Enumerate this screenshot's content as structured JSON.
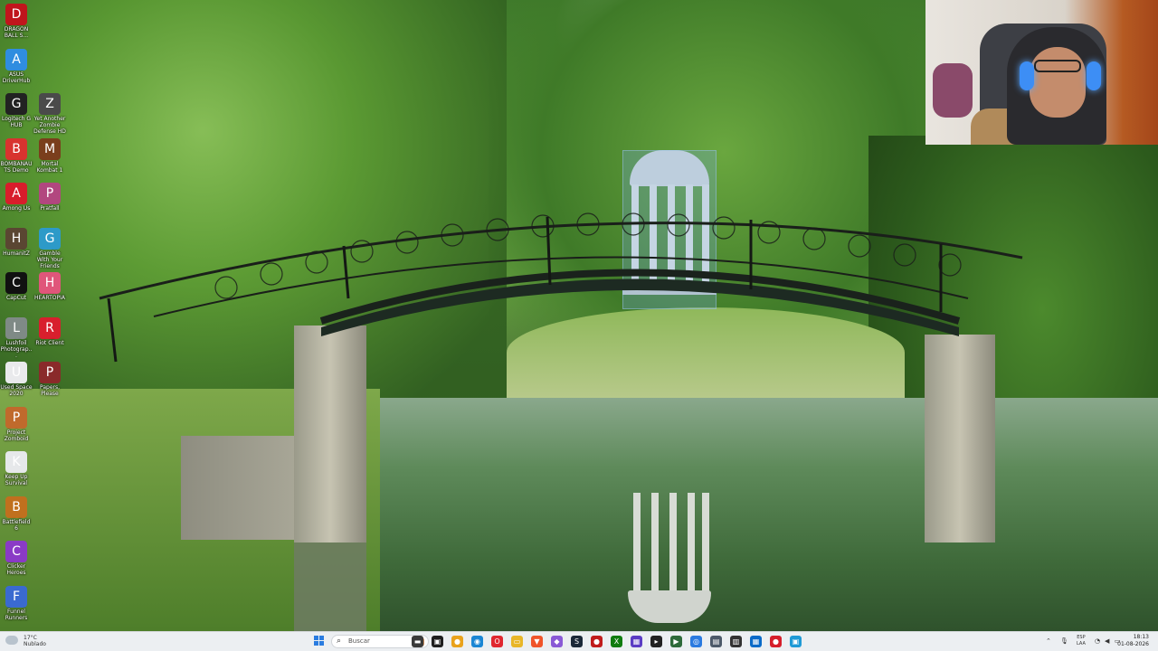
{
  "desktop": {
    "icons": [
      {
        "label": "DRAGON BALL S...",
        "glyph": "D",
        "color": "#c0151c"
      },
      {
        "label": "ASUS DriverHub",
        "glyph": "A",
        "color": "#2f8de0"
      },
      {
        "label": "Logitech G HUB",
        "glyph": "G",
        "color": "#222222"
      },
      {
        "label": "Yet Another Zombie Defense HD",
        "glyph": "Z",
        "color": "#4a4a4a"
      },
      {
        "label": "BOMBANAUTS Demo",
        "glyph": "B",
        "color": "#d8332f"
      },
      {
        "label": "Mortal Kombat 1",
        "glyph": "M",
        "color": "#7a3e1c"
      },
      {
        "label": "Among Us",
        "glyph": "A",
        "color": "#d81d2b"
      },
      {
        "label": "Pratfall",
        "glyph": "P",
        "color": "#b2477f"
      },
      {
        "label": "HumanitZ",
        "glyph": "H",
        "color": "#5a4632"
      },
      {
        "label": "Gamble With Your Friends",
        "glyph": "G",
        "color": "#2d9ac8"
      },
      {
        "label": "CapCut",
        "glyph": "C",
        "color": "#111111"
      },
      {
        "label": "HEARTOPIA",
        "glyph": "H",
        "color": "#e0567a"
      },
      {
        "label": "Lushfoil Photograp...",
        "glyph": "L",
        "color": "#7f8a86"
      },
      {
        "label": "Riot Client",
        "glyph": "R",
        "color": "#d81f2d"
      },
      {
        "label": "Used Space 2020",
        "glyph": "U",
        "color": "#e9eaec"
      },
      {
        "label": "Papers, Please",
        "glyph": "P",
        "color": "#8a2a2a"
      },
      {
        "label": "Project Zomboid",
        "glyph": "P",
        "color": "#c06a2c"
      },
      {
        "label": "Keep Up Survival",
        "glyph": "K",
        "color": "#e6e8ea"
      },
      {
        "label": "Battlefield 6",
        "glyph": "B",
        "color": "#c0701e"
      },
      {
        "label": "Clicker Heroes",
        "glyph": "C",
        "color": "#8a3ac6"
      },
      {
        "label": "Funnel Runners",
        "glyph": "F",
        "color": "#3a6ad0"
      }
    ]
  },
  "taskbar": {
    "weather": {
      "temp": "17°C",
      "condition": "Nublado"
    },
    "search_placeholder": "Buscar",
    "apps": [
      {
        "name": "file-explorer",
        "glyph": "▬",
        "color": "#3a3a3a"
      },
      {
        "name": "app-2",
        "glyph": "▣",
        "color": "#1e1e1e"
      },
      {
        "name": "chrome",
        "glyph": "●",
        "color": "#e9a21c"
      },
      {
        "name": "edge",
        "glyph": "◉",
        "color": "#1b86d4"
      },
      {
        "name": "opera",
        "glyph": "O",
        "color": "#e0272f"
      },
      {
        "name": "folder",
        "glyph": "▭",
        "color": "#e8b628"
      },
      {
        "name": "brave",
        "glyph": "▼",
        "color": "#f0542a"
      },
      {
        "name": "app-8",
        "glyph": "◆",
        "color": "#8a5ad6"
      },
      {
        "name": "steam",
        "glyph": "S",
        "color": "#1b2838"
      },
      {
        "name": "app-10",
        "glyph": "●",
        "color": "#c01c1c"
      },
      {
        "name": "xbox",
        "glyph": "X",
        "color": "#107c10"
      },
      {
        "name": "app-12",
        "glyph": "▦",
        "color": "#5b3cc4"
      },
      {
        "name": "terminal",
        "glyph": "▸",
        "color": "#222222"
      },
      {
        "name": "app-14",
        "glyph": "▶",
        "color": "#2e6a3a"
      },
      {
        "name": "app-15",
        "glyph": "◎",
        "color": "#2a7ae0"
      },
      {
        "name": "app-16",
        "glyph": "▤",
        "color": "#4d5a6a"
      },
      {
        "name": "app-17",
        "glyph": "▥",
        "color": "#333333"
      },
      {
        "name": "app-18",
        "glyph": "▦",
        "color": "#0a6ac8"
      },
      {
        "name": "app-19",
        "glyph": "●",
        "color": "#d61f2b"
      },
      {
        "name": "app-20",
        "glyph": "▣",
        "color": "#1f9ad6"
      }
    ],
    "language": {
      "line1": "ESP",
      "line2": "LAA"
    },
    "clock": {
      "time": "18:13",
      "date": "01-08-2026"
    }
  },
  "colors": {
    "taskbar_bg": "#eceff2",
    "accent": "#2a7ce0"
  }
}
